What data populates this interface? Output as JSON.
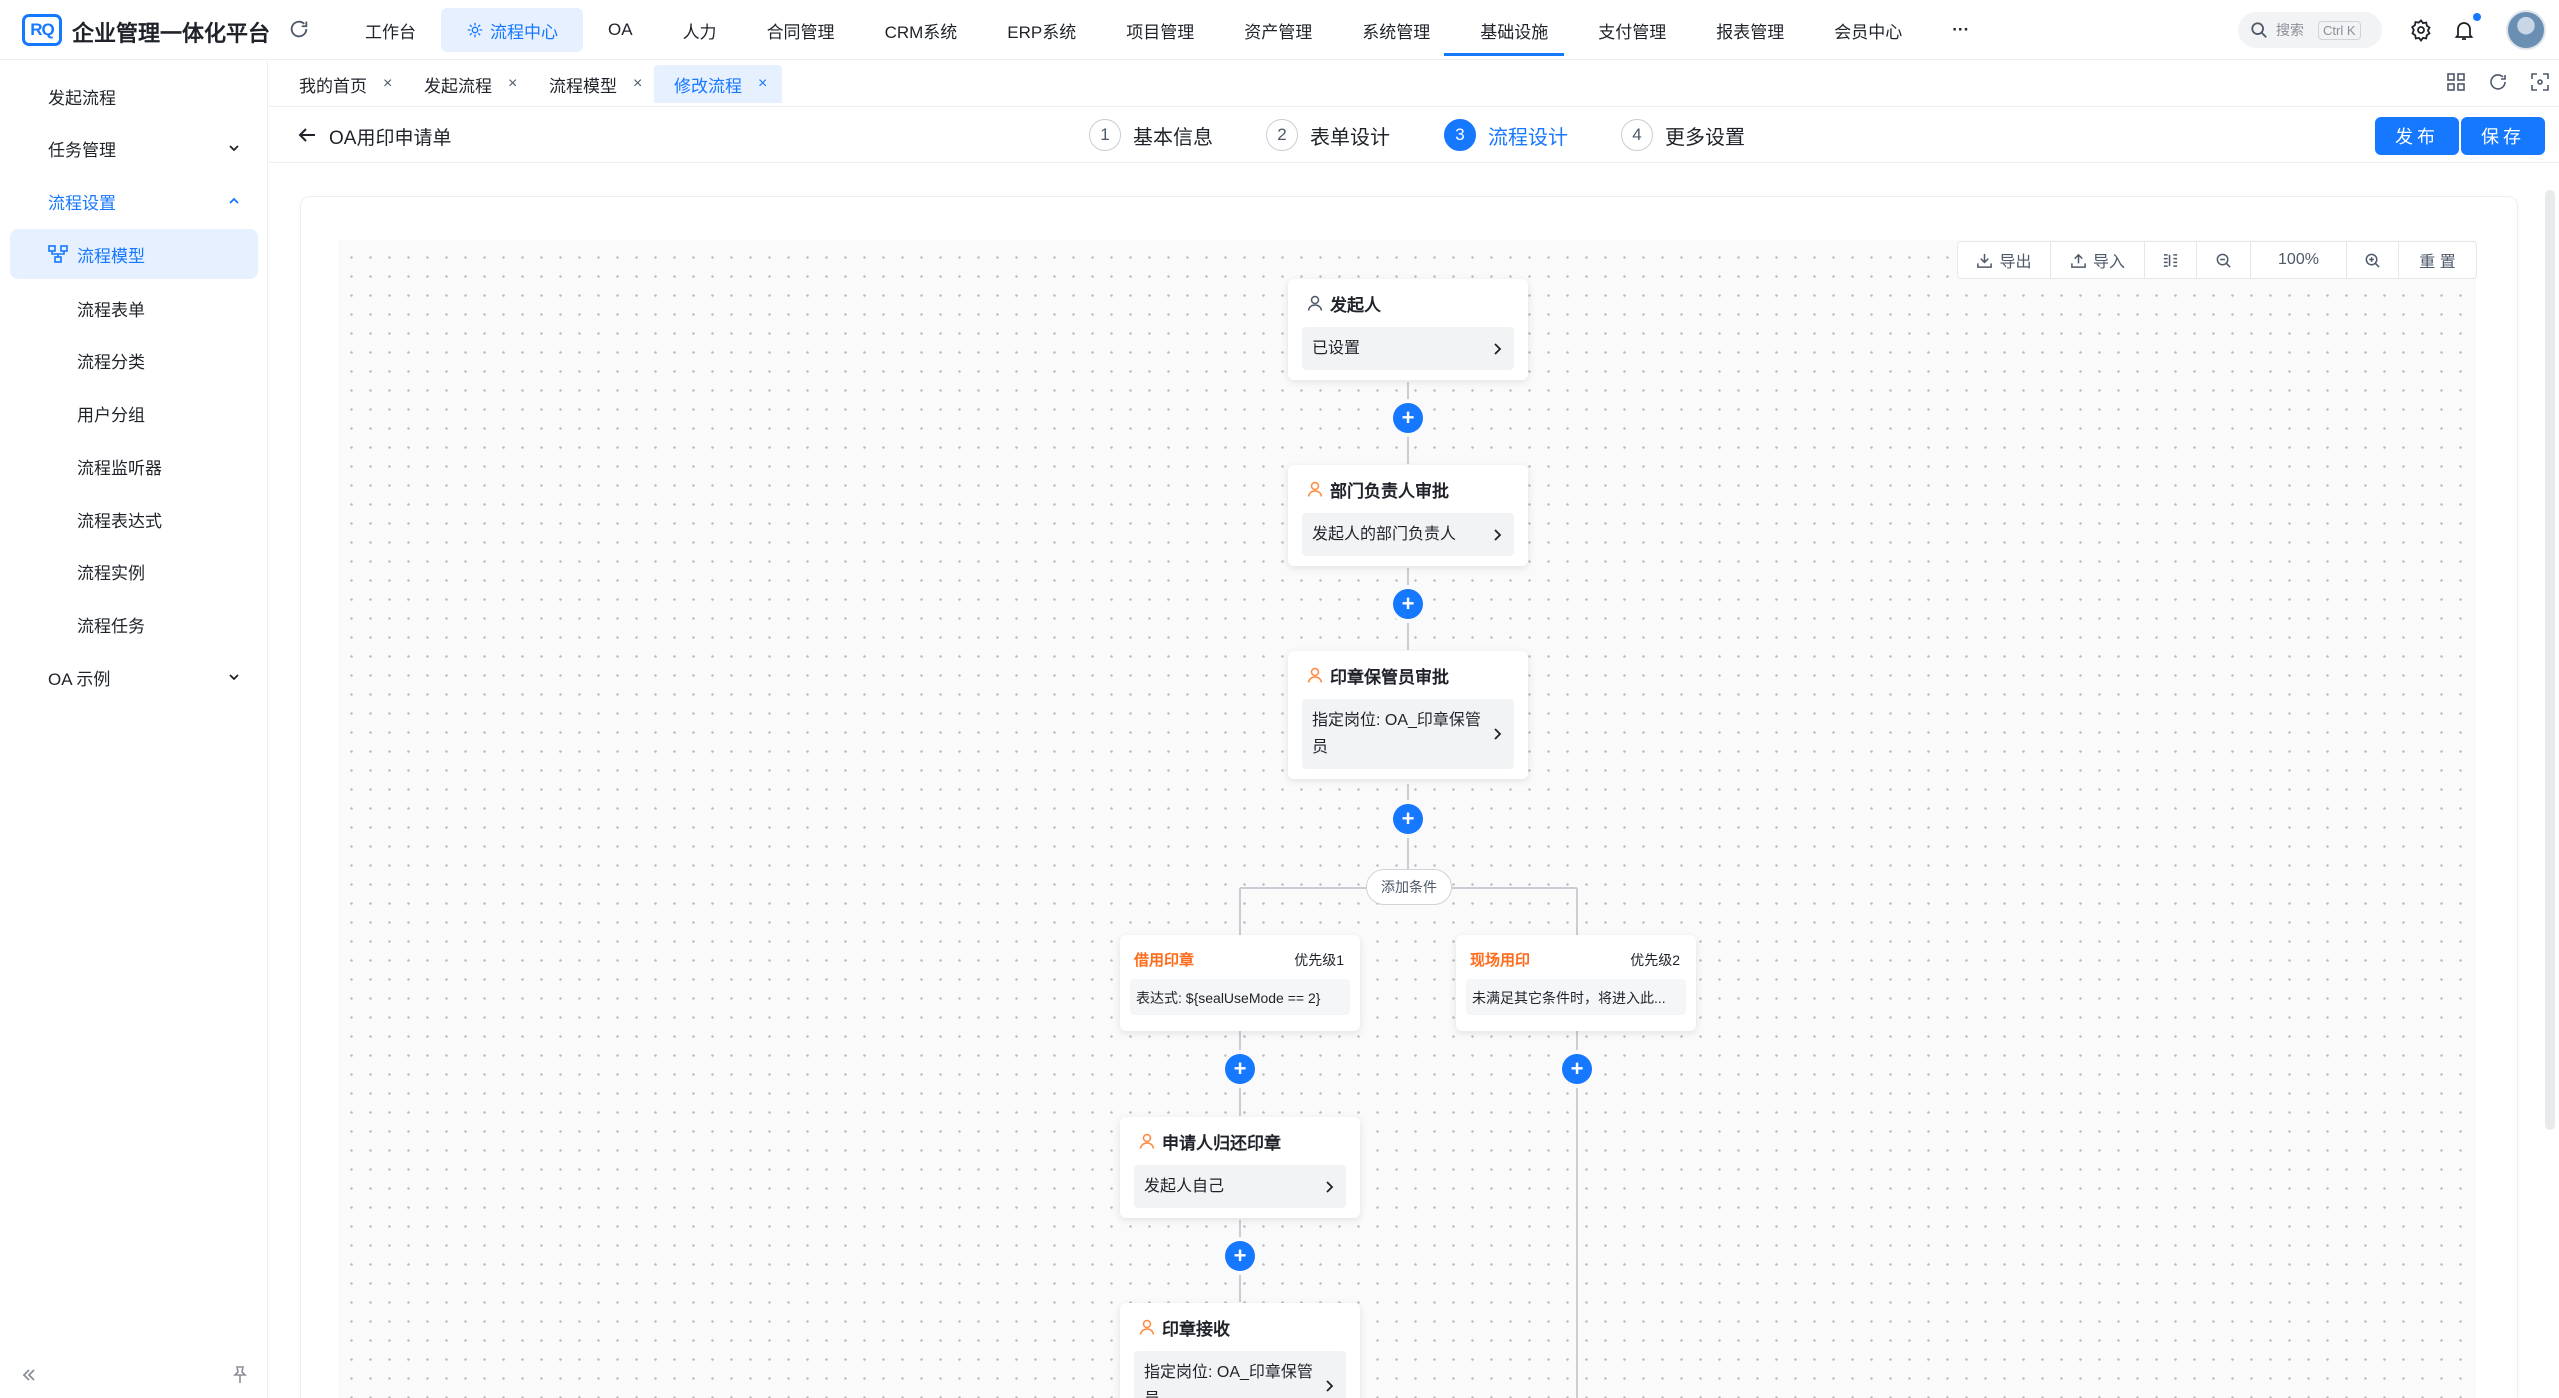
{
  "app": {
    "logo_text": "RQ",
    "title": "企业管理一体化平台",
    "brand_color": "#1677ff"
  },
  "topnav": [
    {
      "label": "工作台"
    },
    {
      "label": "流程中心",
      "active": true
    },
    {
      "label": "OA"
    },
    {
      "label": "人力"
    },
    {
      "label": "合同管理"
    },
    {
      "label": "CRM系统"
    },
    {
      "label": "ERP系统"
    },
    {
      "label": "项目管理"
    },
    {
      "label": "资产管理"
    },
    {
      "label": "系统管理"
    },
    {
      "label": "基础设施"
    },
    {
      "label": "支付管理"
    },
    {
      "label": "报表管理"
    },
    {
      "label": "会员中心"
    },
    {
      "label": "···"
    }
  ],
  "search": {
    "placeholder": "搜索",
    "shortcut": "Ctrl K"
  },
  "sidebar": {
    "items": [
      {
        "label": "发起流程"
      },
      {
        "label": "任务管理"
      },
      {
        "label": "流程设置"
      },
      {
        "label": "流程模型"
      },
      {
        "label": "流程表单"
      },
      {
        "label": "流程分类"
      },
      {
        "label": "用户分组"
      },
      {
        "label": "流程监听器"
      },
      {
        "label": "流程表达式"
      },
      {
        "label": "流程实例"
      },
      {
        "label": "流程任务"
      },
      {
        "label": "OA 示例"
      }
    ]
  },
  "tabs": [
    {
      "label": "我的首页"
    },
    {
      "label": "发起流程"
    },
    {
      "label": "流程模型"
    },
    {
      "label": "修改流程",
      "active": true
    }
  ],
  "editor": {
    "form_name": "OA用印申请单",
    "steps": [
      {
        "num": "1",
        "label": "基本信息"
      },
      {
        "num": "2",
        "label": "表单设计"
      },
      {
        "num": "3",
        "label": "流程设计",
        "active": true
      },
      {
        "num": "4",
        "label": "更多设置"
      }
    ],
    "publish_label": "发布",
    "save_label": "保存"
  },
  "toolbar": {
    "export_label": "导出",
    "import_label": "导入",
    "zoom_level": "100%",
    "reset_label": "重 置"
  },
  "flow": {
    "initiator": {
      "title": "发起人",
      "content": "已设置"
    },
    "dept_approve": {
      "title": "部门负责人审批",
      "content": "发起人的部门负责人"
    },
    "seal_keeper": {
      "title": "印章保管员审批",
      "content": "指定岗位: OA_印章保管员"
    },
    "add_condition_label": "添加条件",
    "branch_left": {
      "name": "借用印章",
      "priority": "优先级1",
      "expression": "表达式: ${sealUseMode == 2}"
    },
    "branch_right": {
      "name": "现场用印",
      "priority": "优先级2",
      "expression": "未满足其它条件时，将进入此..."
    },
    "return_seal": {
      "title": "申请人归还印章",
      "content": "发起人自己"
    },
    "seal_receive": {
      "title": "印章接收",
      "content": "指定岗位: OA_印章保管员"
    }
  }
}
